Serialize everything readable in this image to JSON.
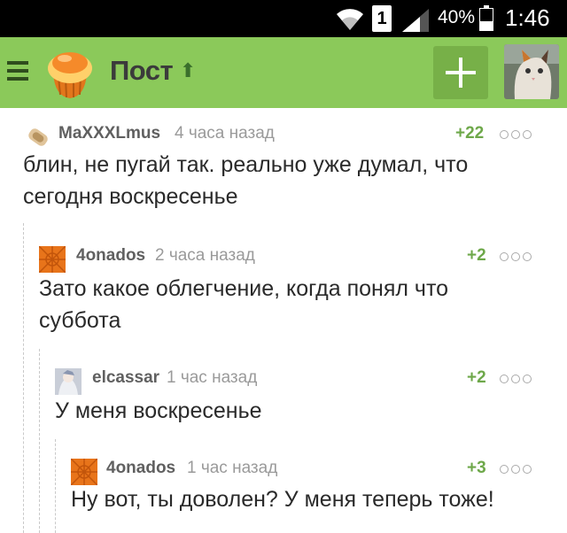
{
  "status_bar": {
    "sim_slot": "1",
    "battery_percent": "40%",
    "battery_level": 0.4,
    "time": "1:46"
  },
  "toolbar": {
    "title": "Пост",
    "logo": "pikabu-logo",
    "up_icon": "arrow-up-icon",
    "add_icon": "plus-icon",
    "menu_icon": "hamburger-menu-icon",
    "colors": {
      "bar": "#8bc95a",
      "add_button": "#77b048"
    }
  },
  "comments": [
    {
      "user": "MaXXXLmus",
      "time": "4 часа назад",
      "rating": "+22",
      "text_lines": [
        "блин, не пугай так. реально уже думал, что",
        "сегодня воскресенье"
      ],
      "depth": 0
    },
    {
      "user": "4onados",
      "time": "2 часа назад",
      "rating": "+2",
      "text_lines": [
        "Зато какое облегчение, когда понял что",
        "суббота"
      ],
      "depth": 1
    },
    {
      "user": "elcassar",
      "time": "1 час назад",
      "rating": "+2",
      "text_lines": [
        "У меня воскресенье"
      ],
      "depth": 2
    },
    {
      "user": "4onados",
      "time": "1 час назад",
      "rating": "+3",
      "text_lines": [
        "Ну вот, ты доволен? У меня теперь тоже!"
      ],
      "depth": 3
    }
  ],
  "colors": {
    "rating": "#6ea84a",
    "username": "#606060",
    "time": "#9a9a9a"
  }
}
